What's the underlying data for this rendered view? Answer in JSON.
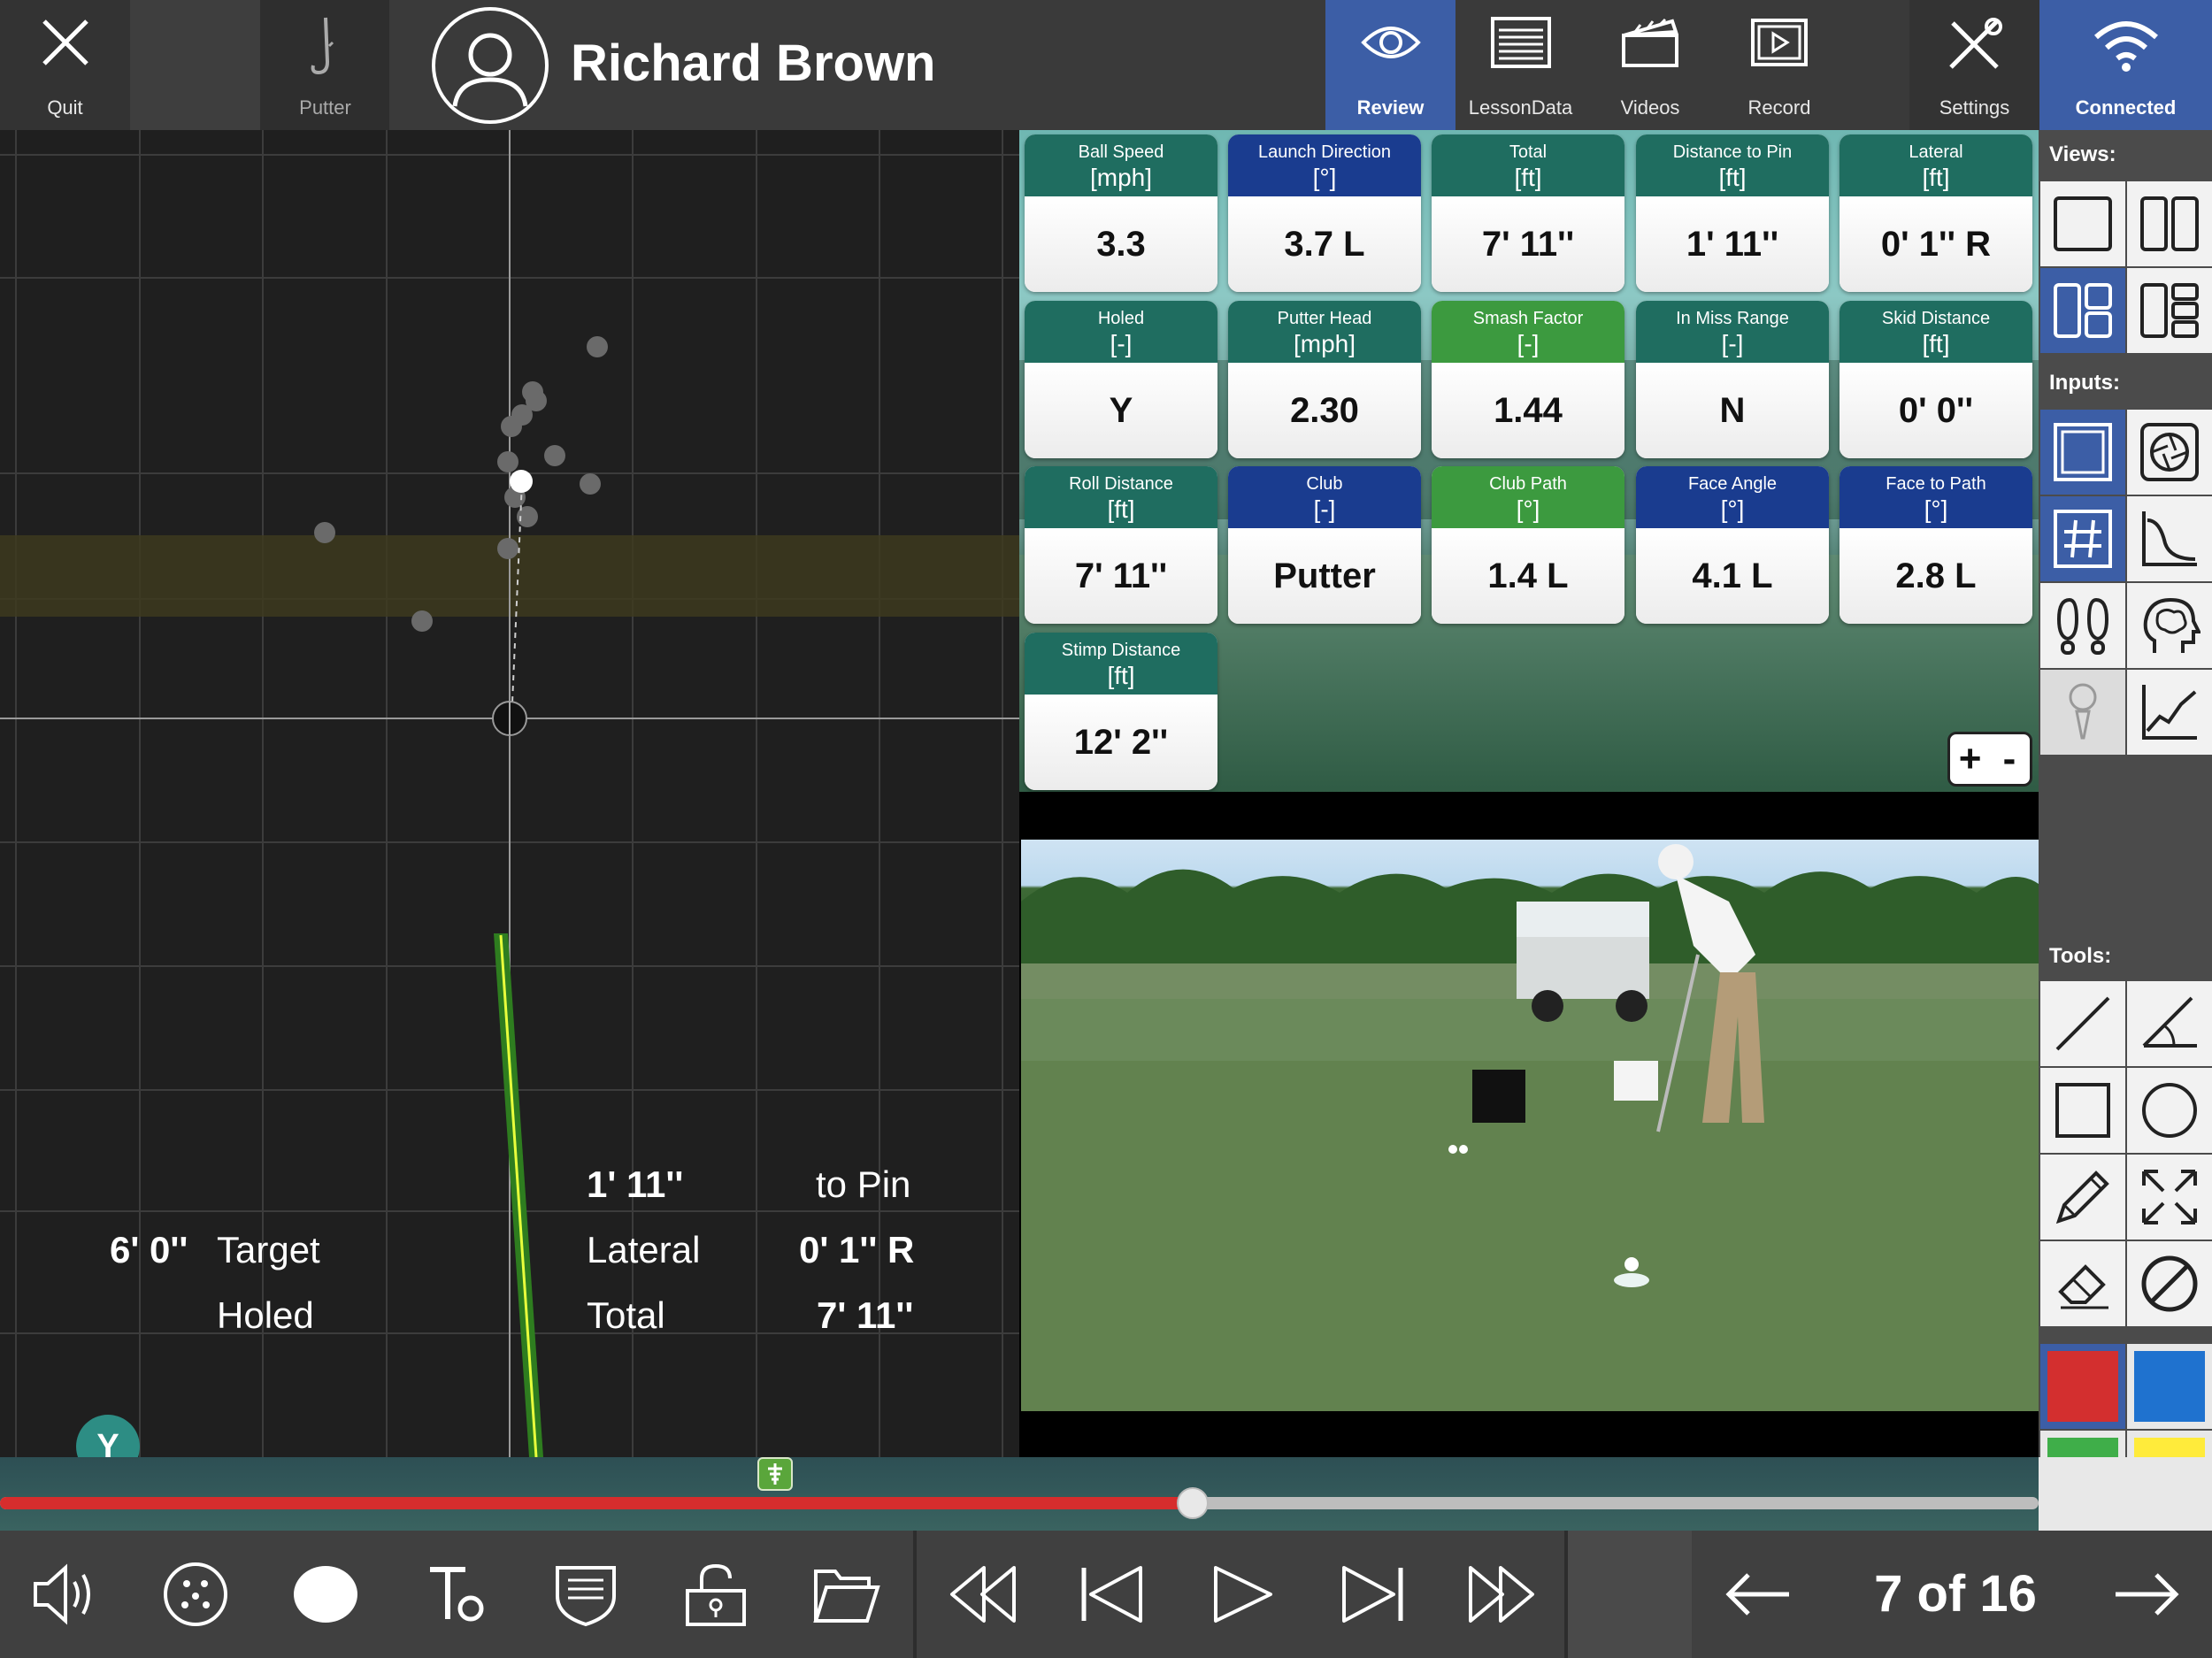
{
  "topbar": {
    "quit_label": "Quit",
    "putter_label": "Putter",
    "user_name": "Richard Brown",
    "review_label": "Review",
    "lesson_label": "LessonData",
    "videos_label": "Videos",
    "record_label": "Record",
    "settings_label": "Settings",
    "connected_label": "Connected"
  },
  "tiles": [
    {
      "name": "Ball Speed",
      "unit": "[mph]",
      "value": "3.3",
      "color": "teal"
    },
    {
      "name": "Launch Direction",
      "unit": "[°]",
      "value": "3.7 L",
      "color": "blue"
    },
    {
      "name": "Total",
      "unit": "[ft]",
      "value": "7' 11''",
      "color": "teal"
    },
    {
      "name": "Distance to Pin",
      "unit": "[ft]",
      "value": "1' 11''",
      "color": "teal"
    },
    {
      "name": "Lateral",
      "unit": "[ft]",
      "value": "0' 1'' R",
      "color": "teal"
    },
    {
      "name": "Holed",
      "unit": "[-]",
      "value": "Y",
      "color": "teal"
    },
    {
      "name": "Putter Head",
      "unit": "[mph]",
      "value": "2.30",
      "color": "teal"
    },
    {
      "name": "Smash Factor",
      "unit": "[-]",
      "value": "1.44",
      "color": "green"
    },
    {
      "name": "In Miss Range",
      "unit": "[-]",
      "value": "N",
      "color": "teal"
    },
    {
      "name": "Skid Distance",
      "unit": "[ft]",
      "value": "0' 0''",
      "color": "teal"
    },
    {
      "name": "Roll Distance",
      "unit": "[ft]",
      "value": "7' 11''",
      "color": "teal"
    },
    {
      "name": "Club",
      "unit": "[-]",
      "value": "Putter",
      "color": "blue"
    },
    {
      "name": "Club Path",
      "unit": "[°]",
      "value": "1.4 L",
      "color": "green"
    },
    {
      "name": "Face Angle",
      "unit": "[°]",
      "value": "4.1 L",
      "color": "blue"
    },
    {
      "name": "Face to Path",
      "unit": "[°]",
      "value": "2.8 L",
      "color": "blue"
    },
    {
      "name": "Stimp Distance",
      "unit": "[ft]",
      "value": "12' 2''",
      "color": "teal"
    }
  ],
  "data_panel": {
    "plus_minus": "+ -"
  },
  "overlay": {
    "target_value": "6' 0''",
    "target_label": "Target",
    "holed_badge": "Y",
    "holed_label": "Holed",
    "to_pin_value": "1' 11''",
    "to_pin_label": "to Pin",
    "lateral_label": "Lateral",
    "lateral_value": "0' 1'' R",
    "total_label": "Total",
    "total_value": "7' 11''"
  },
  "sidebar": {
    "views_label": "Views:",
    "inputs_label": "Inputs:",
    "tools_label": "Tools:",
    "colors": [
      "#d32f2f",
      "#1f72cf",
      "#3fae49",
      "#ffeb3b"
    ]
  },
  "timeline": {
    "progress": 0.585,
    "marker_icon": "flag-icon"
  },
  "bottombar": {
    "page_counter": "7 of 16"
  },
  "colors": {
    "accent_blue": "#3c5ea6",
    "tile_teal": "#1f6d60",
    "tile_blue": "#1a3c8f",
    "tile_green": "#3c9a3f",
    "timeline_red": "#d62d2d",
    "holed_badge": "#2d8d84"
  }
}
